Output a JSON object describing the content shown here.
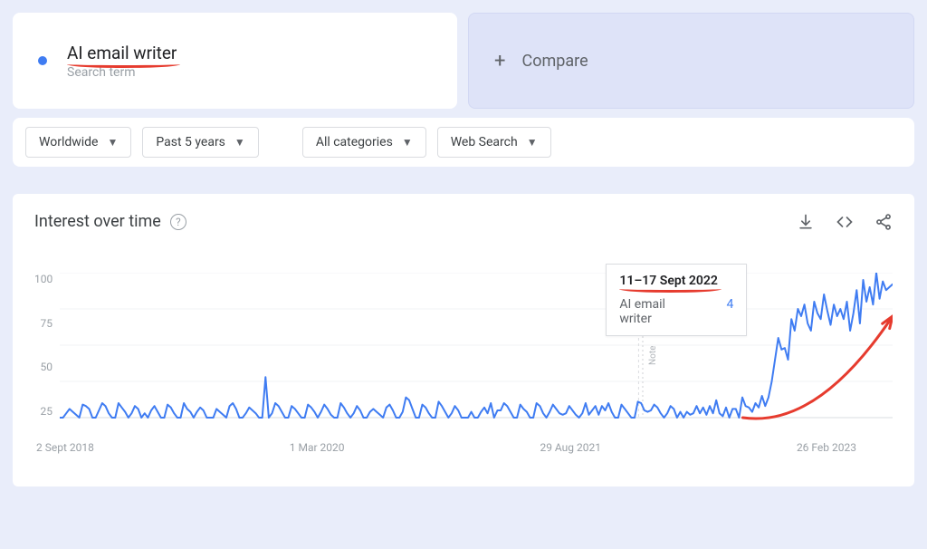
{
  "search": {
    "term": "AI email writer",
    "subtitle": "Search term"
  },
  "compare": {
    "label": "Compare",
    "plus": "+"
  },
  "filters": {
    "geo": "Worldwide",
    "time": "Past 5 years",
    "category": "All categories",
    "type": "Web Search"
  },
  "chart": {
    "title": "Interest over time",
    "help": "?",
    "note_label": "Note"
  },
  "tooltip": {
    "date": "11–17 Sept 2022",
    "term": "AI email writer",
    "value": "4"
  },
  "chart_data": {
    "type": "line",
    "title": "Interest over time",
    "xlabel": "",
    "ylabel": "",
    "ylim": [
      0,
      100
    ],
    "y_ticks": [
      "100",
      "75",
      "50",
      "25"
    ],
    "x_ticks": [
      "2 Sept 2018",
      "1 Mar 2020",
      "29 Aug 2021",
      "26 Feb 2023"
    ],
    "xrange": [
      "2018-09-02",
      "2023-09-02"
    ],
    "series": [
      {
        "name": "AI email writer",
        "color": "#3f7cf2",
        "values": [
          0,
          0,
          3,
          6,
          4,
          2,
          0,
          9,
          8,
          6,
          0,
          0,
          5,
          10,
          8,
          3,
          0,
          0,
          10,
          7,
          4,
          0,
          3,
          8,
          6,
          0,
          3,
          0,
          5,
          8,
          4,
          0,
          0,
          9,
          7,
          3,
          0,
          0,
          10,
          6,
          4,
          0,
          4,
          7,
          5,
          0,
          0,
          0,
          6,
          4,
          2,
          0,
          8,
          10,
          6,
          0,
          0,
          3,
          7,
          5,
          3,
          0,
          0,
          28,
          0,
          3,
          10,
          8,
          4,
          0,
          0,
          8,
          6,
          3,
          0,
          0,
          9,
          7,
          4,
          0,
          4,
          9,
          6,
          2,
          0,
          0,
          10,
          7,
          3,
          0,
          3,
          8,
          5,
          0,
          0,
          4,
          6,
          4,
          2,
          0,
          7,
          9,
          5,
          0,
          0,
          4,
          14,
          12,
          6,
          0,
          0,
          9,
          7,
          3,
          0,
          0,
          11,
          8,
          4,
          0,
          3,
          8,
          5,
          0,
          0,
          0,
          4,
          0,
          0,
          4,
          7,
          3,
          10,
          0,
          5,
          5,
          10,
          8,
          4,
          0,
          0,
          9,
          6,
          4,
          0,
          0,
          10,
          8,
          3,
          0,
          4,
          9,
          6,
          3,
          2,
          3,
          8,
          5,
          2,
          0,
          3,
          10,
          2,
          5,
          8,
          2,
          8,
          5,
          10,
          4,
          0,
          0,
          9,
          6,
          3,
          0,
          0,
          11,
          10,
          5,
          4,
          5,
          9,
          7,
          3,
          0,
          3,
          8,
          6,
          0,
          4,
          0,
          4,
          2,
          3,
          8,
          3,
          7,
          2,
          8,
          3,
          12,
          3,
          1,
          7,
          0,
          6,
          6,
          0,
          14,
          8,
          7,
          4,
          10,
          7,
          15,
          8,
          14,
          25,
          40,
          55,
          47,
          48,
          40,
          68,
          60,
          75,
          70,
          78,
          65,
          60,
          80,
          72,
          68,
          85,
          74,
          64,
          78,
          70,
          75,
          68,
          80,
          60,
          72,
          88,
          65,
          95,
          80,
          90,
          78,
          100,
          82,
          94,
          88,
          90,
          92
        ]
      }
    ],
    "highlight": {
      "date": "11–17 Sept 2022",
      "value": 4
    },
    "annotation_arrow": {
      "from_x_frac": 0.82,
      "from_y_value": 0,
      "to_x_frac": 1.0,
      "to_y_value": 70,
      "color": "#e63b2e"
    }
  }
}
